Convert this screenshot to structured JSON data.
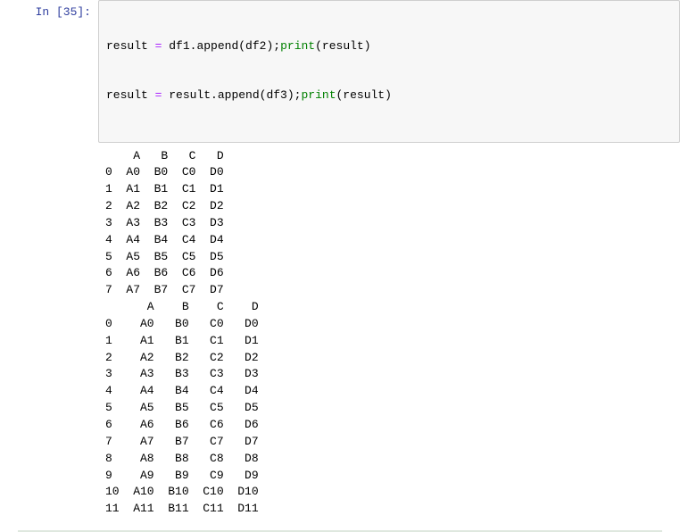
{
  "cell": {
    "prompt_label": "In [35]:",
    "code": {
      "line1": {
        "t1": "result ",
        "t2": "=",
        "t3": " df1",
        "t4": ".",
        "t5": "append(df2)",
        "t6": ";",
        "t7": "print",
        "t8": "(result)"
      },
      "line2": {
        "t1": "result ",
        "t2": "=",
        "t3": " result",
        "t4": ".",
        "t5": "append(df3)",
        "t6": ";",
        "t7": "print",
        "t8": "(result)"
      }
    }
  },
  "output": {
    "table1": {
      "header": "    A   B   C   D",
      "rows": [
        "0  A0  B0  C0  D0",
        "1  A1  B1  C1  D1",
        "2  A2  B2  C2  D2",
        "3  A3  B3  C3  D3",
        "4  A4  B4  C4  D4",
        "5  A5  B5  C5  D5",
        "6  A6  B6  C6  D6",
        "7  A7  B7  C7  D7"
      ]
    },
    "table2": {
      "header": "      A    B    C    D",
      "rows": [
        "0    A0   B0   C0   D0",
        "1    A1   B1   C1   D1",
        "2    A2   B2   C2   D2",
        "3    A3   B3   C3   D3",
        "4    A4   B4   C4   D4",
        "5    A5   B5   C5   D5",
        "6    A6   B6   C6   D6",
        "7    A7   B7   C7   D7",
        "8    A8   B8   C8   D8",
        "9    A9   B9   C9   D9",
        "10  A10  B10  C10  D10",
        "11  A11  B11  C11  D11"
      ]
    }
  }
}
